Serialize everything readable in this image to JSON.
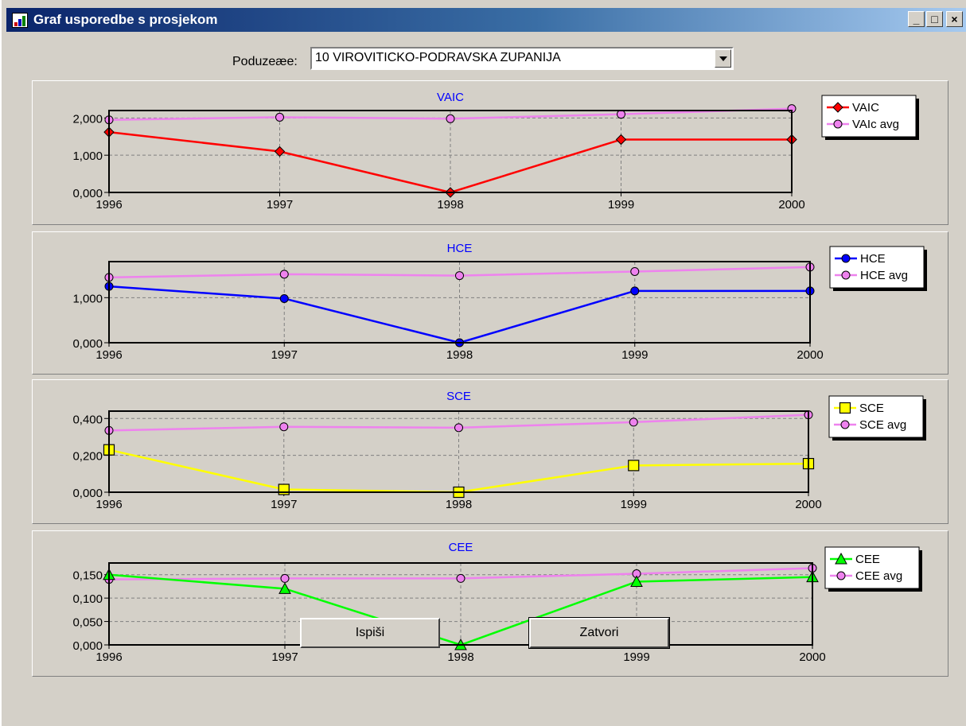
{
  "window": {
    "title": "Graf usporedbe s prosjekom",
    "min_symbol": "_",
    "max_symbol": "□",
    "close_symbol": "×"
  },
  "company": {
    "label": "Poduzeæe:",
    "selected": "10 VIROVITICKO-PODRAVSKA ZUPANIJA"
  },
  "buttons": {
    "print": "Ispiši",
    "close": "Zatvori"
  },
  "colors": {
    "accent": "#0000ff",
    "avg_line": "#ee82ee",
    "avg_marker": "#ee82ee"
  },
  "chart_data": [
    {
      "type": "line",
      "title": "VAIC",
      "x": [
        1996,
        1997,
        1998,
        1999,
        2000
      ],
      "ylim": [
        0,
        2.2
      ],
      "yticks": [
        0,
        1,
        2
      ],
      "ytick_labels": [
        "0,000",
        "1,000",
        "2,000"
      ],
      "series": [
        {
          "name": "VAIC",
          "values": [
            1.62,
            1.1,
            0.0,
            1.42,
            1.42
          ],
          "color": "#ff0000",
          "marker": "diamond"
        },
        {
          "name": "VAIc avg",
          "values": [
            1.95,
            2.02,
            1.98,
            2.1,
            2.25
          ],
          "color": "#ee82ee",
          "marker": "circle"
        }
      ]
    },
    {
      "type": "line",
      "title": "HCE",
      "x": [
        1996,
        1997,
        1998,
        1999,
        2000
      ],
      "ylim": [
        0,
        1.8
      ],
      "yticks": [
        0,
        1
      ],
      "ytick_labels": [
        "0,000",
        "1,000"
      ],
      "series": [
        {
          "name": "HCE",
          "values": [
            1.25,
            0.98,
            0.0,
            1.15,
            1.15
          ],
          "color": "#0000ff",
          "marker": "circle"
        },
        {
          "name": "HCE avg",
          "values": [
            1.45,
            1.52,
            1.49,
            1.58,
            1.68
          ],
          "color": "#ee82ee",
          "marker": "circle"
        }
      ]
    },
    {
      "type": "line",
      "title": "SCE",
      "x": [
        1996,
        1997,
        1998,
        1999,
        2000
      ],
      "ylim": [
        0,
        0.44
      ],
      "yticks": [
        0,
        0.2,
        0.4
      ],
      "ytick_labels": [
        "0,000",
        "0,200",
        "0,400"
      ],
      "series": [
        {
          "name": "SCE",
          "values": [
            0.23,
            0.015,
            0.0,
            0.145,
            0.155
          ],
          "color": "#ffff00",
          "marker": "square"
        },
        {
          "name": "SCE avg",
          "values": [
            0.335,
            0.355,
            0.35,
            0.38,
            0.42
          ],
          "color": "#ee82ee",
          "marker": "circle"
        }
      ]
    },
    {
      "type": "line",
      "title": "CEE",
      "x": [
        1996,
        1997,
        1998,
        1999,
        2000
      ],
      "ylim": [
        0,
        0.175
      ],
      "yticks": [
        0,
        0.05,
        0.1,
        0.15
      ],
      "ytick_labels": [
        "0,000",
        "0,050",
        "0,100",
        "0,150"
      ],
      "series": [
        {
          "name": "CEE",
          "values": [
            0.15,
            0.12,
            0.0,
            0.135,
            0.145
          ],
          "color": "#00ff00",
          "marker": "triangle"
        },
        {
          "name": "CEE avg",
          "values": [
            0.14,
            0.142,
            0.142,
            0.152,
            0.164
          ],
          "color": "#ee82ee",
          "marker": "circle"
        }
      ]
    }
  ]
}
